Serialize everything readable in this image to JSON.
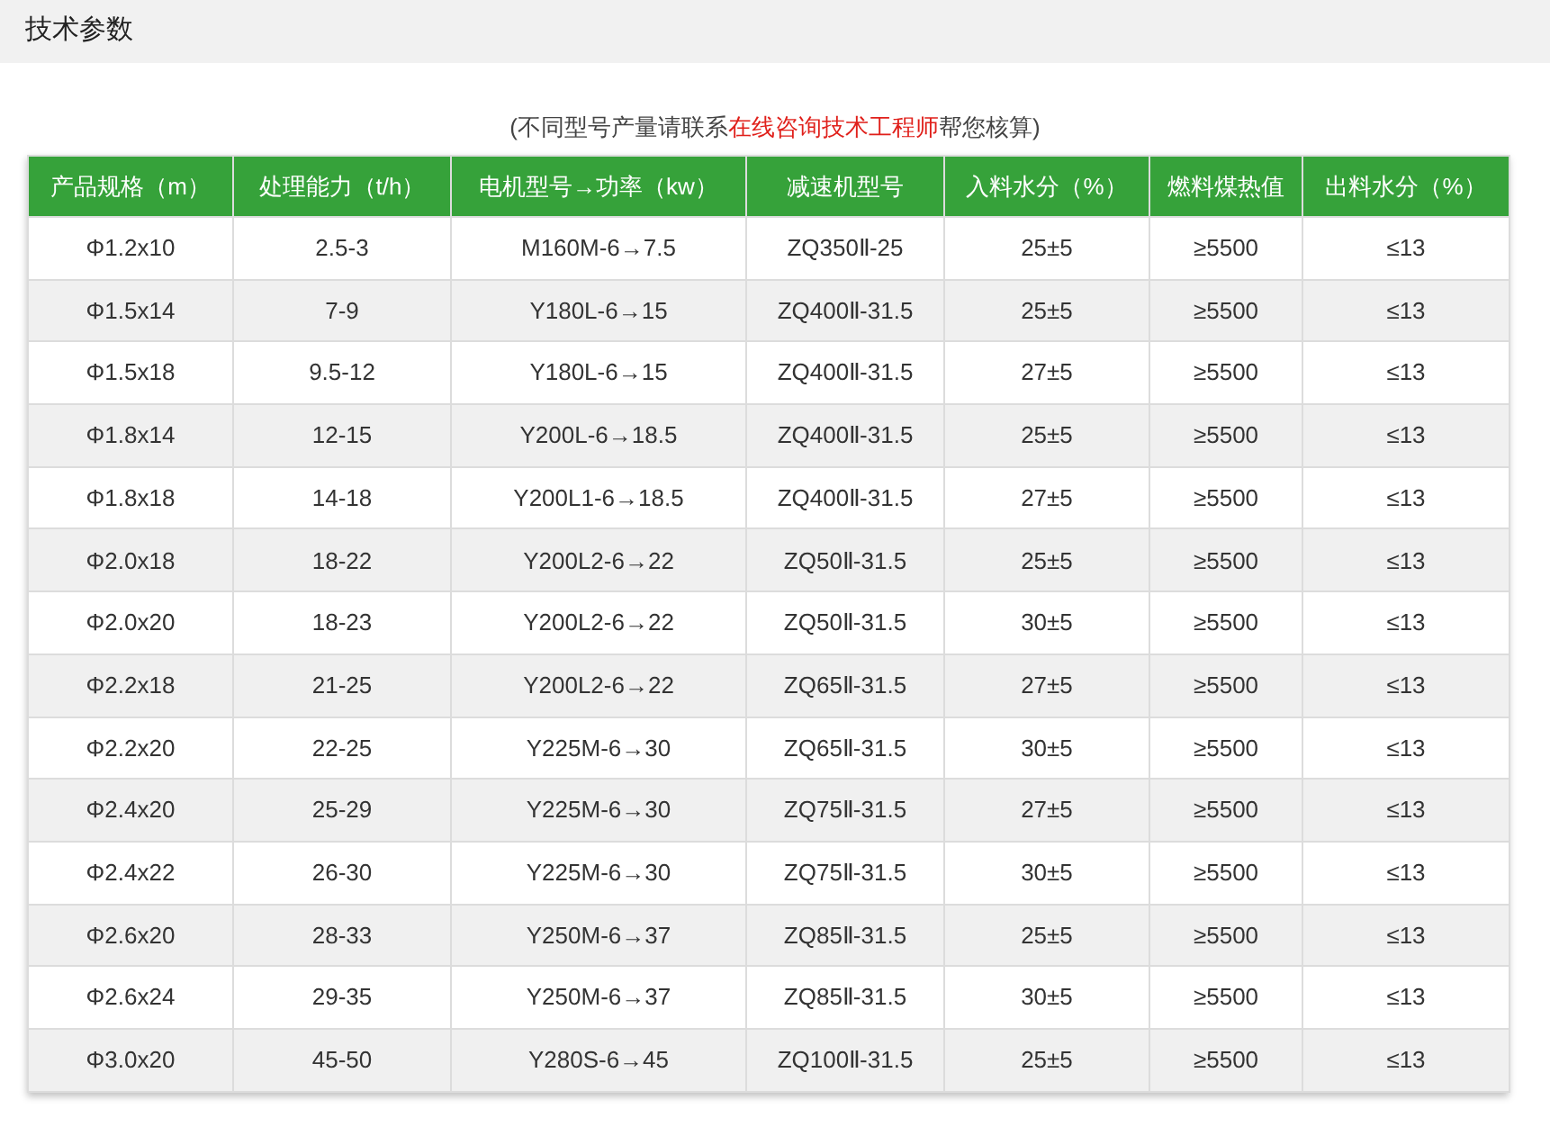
{
  "section_title": "技术参数",
  "note": {
    "before": "(不同型号产量请联系",
    "link": "在线咨询技术工程师",
    "after": "帮您核算)"
  },
  "table": {
    "columns": [
      "产品规格（m）",
      "处理能力（t/h）",
      "电机型号→功率（kw）",
      "减速机型号",
      "入料水分（%）",
      "燃料煤热值",
      "出料水分（%）"
    ],
    "rows": [
      [
        "Φ1.2x10",
        "2.5-3",
        "M160M-6→7.5",
        "ZQ350Ⅱ-25",
        "25±5",
        "≥5500",
        "≤13"
      ],
      [
        "Φ1.5x14",
        "7-9",
        "Y180L-6→15",
        "ZQ400Ⅱ-31.5",
        "25±5",
        "≥5500",
        "≤13"
      ],
      [
        "Φ1.5x18",
        "9.5-12",
        "Y180L-6→15",
        "ZQ400Ⅱ-31.5",
        "27±5",
        "≥5500",
        "≤13"
      ],
      [
        "Φ1.8x14",
        "12-15",
        "Y200L-6→18.5",
        "ZQ400Ⅱ-31.5",
        "25±5",
        "≥5500",
        "≤13"
      ],
      [
        "Φ1.8x18",
        "14-18",
        "Y200L1-6→18.5",
        "ZQ400Ⅱ-31.5",
        "27±5",
        "≥5500",
        "≤13"
      ],
      [
        "Φ2.0x18",
        "18-22",
        "Y200L2-6→22",
        "ZQ50Ⅱ-31.5",
        "25±5",
        "≥5500",
        "≤13"
      ],
      [
        "Φ2.0x20",
        "18-23",
        "Y200L2-6→22",
        "ZQ50Ⅱ-31.5",
        "30±5",
        "≥5500",
        "≤13"
      ],
      [
        "Φ2.2x18",
        "21-25",
        "Y200L2-6→22",
        "ZQ65Ⅱ-31.5",
        "27±5",
        "≥5500",
        "≤13"
      ],
      [
        "Φ2.2x20",
        "22-25",
        "Y225M-6→30",
        "ZQ65Ⅱ-31.5",
        "30±5",
        "≥5500",
        "≤13"
      ],
      [
        "Φ2.4x20",
        "25-29",
        "Y225M-6→30",
        "ZQ75Ⅱ-31.5",
        "27±5",
        "≥5500",
        "≤13"
      ],
      [
        "Φ2.4x22",
        "26-30",
        "Y225M-6→30",
        "ZQ75Ⅱ-31.5",
        "30±5",
        "≥5500",
        "≤13"
      ],
      [
        "Φ2.6x20",
        "28-33",
        "Y250M-6→37",
        "ZQ85Ⅱ-31.5",
        "25±5",
        "≥5500",
        "≤13"
      ],
      [
        "Φ2.6x24",
        "29-35",
        "Y250M-6→37",
        "ZQ85Ⅱ-31.5",
        "30±5",
        "≥5500",
        "≤13"
      ],
      [
        "Φ3.0x20",
        "45-50",
        "Y280S-6→45",
        "ZQ100Ⅱ-31.5",
        "25±5",
        "≥5500",
        "≤13"
      ]
    ]
  }
}
